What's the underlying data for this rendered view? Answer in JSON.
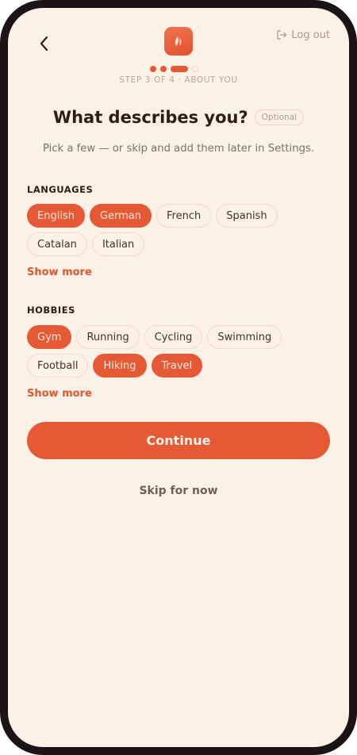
{
  "header": {
    "back_icon": "chevron-left-icon",
    "logo_icon": "app-logo-icon",
    "logout_label": "Log out",
    "logout_icon": "logout-icon",
    "step_text": "STEP 3 OF 4 · ABOUT YOU",
    "progress": {
      "current": 3,
      "total": 4
    }
  },
  "main": {
    "title": "What describes you?",
    "optional_badge": "Optional",
    "subtitle": "Pick a few — or skip and add them later in Settings."
  },
  "sections": [
    {
      "label": "LANGUAGES",
      "show_more": "Show more",
      "chips": [
        {
          "label": "English",
          "selected": true
        },
        {
          "label": "German",
          "selected": true
        },
        {
          "label": "French",
          "selected": false
        },
        {
          "label": "Spanish",
          "selected": false
        },
        {
          "label": "Catalan",
          "selected": false
        },
        {
          "label": "Italian",
          "selected": false
        }
      ]
    },
    {
      "label": "HOBBIES",
      "show_more": "Show more",
      "chips": [
        {
          "label": "Gym",
          "selected": true
        },
        {
          "label": "Running",
          "selected": false
        },
        {
          "label": "Cycling",
          "selected": false
        },
        {
          "label": "Swimming",
          "selected": false
        },
        {
          "label": "Football",
          "selected": false
        },
        {
          "label": "Hiking",
          "selected": true
        },
        {
          "label": "Travel",
          "selected": true
        }
      ]
    }
  ],
  "actions": {
    "continue_label": "Continue",
    "skip_label": "Skip for now"
  },
  "colors": {
    "accent": "#e55a35",
    "background": "#fbf1e7",
    "text": "#2e1d16"
  }
}
